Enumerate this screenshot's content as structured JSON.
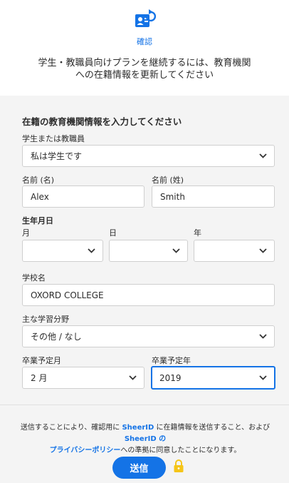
{
  "header": {
    "step_label": "確認",
    "headline_line1": "学生・教職員向けプランを継続するには、教育機関",
    "headline_line2": "への在籍情報を更新してください"
  },
  "form": {
    "section_title": "在籍の教育機関情報を入力してください",
    "role": {
      "label": "学生または教職員",
      "value": "私は学生です"
    },
    "first_name": {
      "label": "名前 (名)",
      "value": "Alex"
    },
    "last_name": {
      "label": "名前 (姓)",
      "value": "Smith"
    },
    "birth": {
      "label": "生年月日",
      "month_label": "月",
      "day_label": "日",
      "year_label": "年",
      "month_value": "",
      "day_value": "",
      "year_value": ""
    },
    "school": {
      "label": "学校名",
      "value": "OXORD COLLEGE"
    },
    "major": {
      "label": "主な学習分野",
      "value": "その他 / なし"
    },
    "grad_month": {
      "label": "卒業予定月",
      "value": "2 月"
    },
    "grad_year": {
      "label": "卒業予定年",
      "value": "2019"
    }
  },
  "footer": {
    "consent_part1": "送信することにより、確認用に ",
    "link_sheerid_1": "SheerID",
    "consent_part2": " に在籍情報を送信すること、および ",
    "link_sheerid_2": "SheerID の",
    "link_privacy": "プライバシーポリシー",
    "consent_part3": "への準拠に同意したことになります。",
    "submit_label": "送信"
  },
  "colors": {
    "accent": "#1473e6",
    "form_background": "#f4f4f4",
    "lock": "#f5c518"
  },
  "icons": [
    "id-card-refresh-icon",
    "chevron-down-icon",
    "lock-icon"
  ]
}
